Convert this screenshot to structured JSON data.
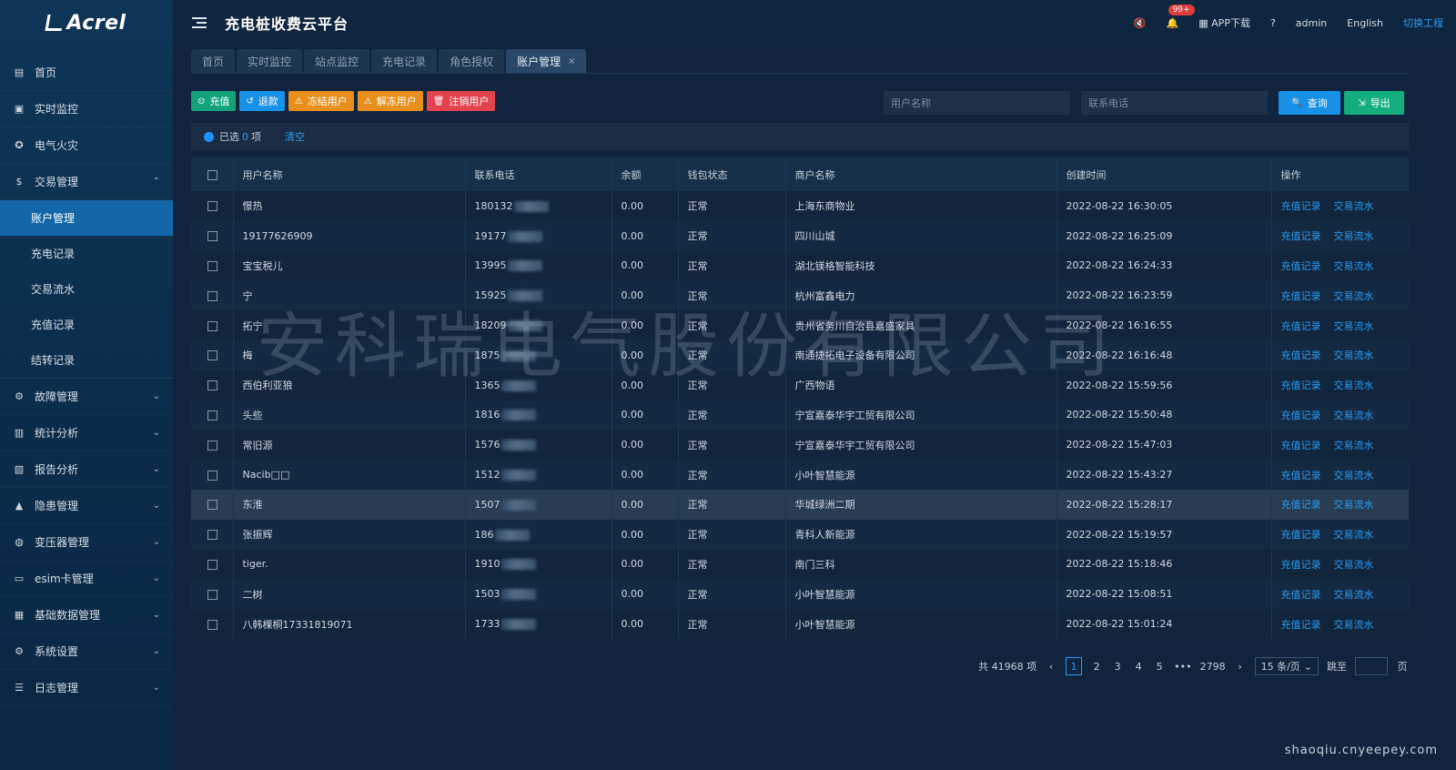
{
  "sidebar": {
    "logo": "Acrel",
    "items": [
      {
        "icon": "home-icon",
        "label": "首页"
      },
      {
        "icon": "monitor-icon",
        "label": "实时监控"
      },
      {
        "icon": "fire-icon",
        "label": "电气火灾"
      },
      {
        "icon": "money-icon",
        "label": "交易管理",
        "expanded": true,
        "children": [
          "账户管理",
          "充电记录",
          "交易流水",
          "充值记录",
          "结转记录"
        ]
      },
      {
        "icon": "fault-icon",
        "label": "故障管理"
      },
      {
        "icon": "chart-icon",
        "label": "统计分析"
      },
      {
        "icon": "report-icon",
        "label": "报告分析"
      },
      {
        "icon": "warning-icon",
        "label": "隐患管理"
      },
      {
        "icon": "transformer-icon",
        "label": "变压器管理"
      },
      {
        "icon": "sim-icon",
        "label": "esim卡管理"
      },
      {
        "icon": "database-icon",
        "label": "基础数据管理"
      },
      {
        "icon": "gear-icon",
        "label": "系统设置"
      },
      {
        "icon": "log-icon",
        "label": "日志管理"
      }
    ],
    "active_child": "账户管理"
  },
  "header": {
    "title": "充电桩收费云平台",
    "badge": "99+",
    "app_download": "APP下载",
    "user": "admin",
    "language": "English",
    "switch_project": "切换工程"
  },
  "tabs": [
    {
      "label": "首页"
    },
    {
      "label": "实时监控"
    },
    {
      "label": "站点监控"
    },
    {
      "label": "充电记录"
    },
    {
      "label": "角色授权"
    },
    {
      "label": "账户管理",
      "active": true,
      "closable": true
    }
  ],
  "toolbar": {
    "recharge": "充值",
    "refund": "退款",
    "freeze": "冻结用户",
    "unfreeze": "解冻用户",
    "cancel": "注销用户"
  },
  "search": {
    "name_placeholder": "用户名称",
    "phone_placeholder": "联系电话",
    "query": "查询",
    "export": "导出"
  },
  "selection": {
    "prefix": "已选",
    "count": "0",
    "suffix": "项",
    "clear": "清空"
  },
  "table": {
    "columns": [
      "用户名称",
      "联系电话",
      "余额",
      "钱包状态",
      "商户名称",
      "创建时间",
      "操作"
    ],
    "actions": [
      "充值记录",
      "交易流水"
    ],
    "rows": [
      {
        "name": "憬热",
        "phone": "180132",
        "balance": "0.00",
        "status": "正常",
        "merchant": "上海东商物业",
        "created": "2022-08-22 16:30:05"
      },
      {
        "name": "19177626909",
        "phone": "19177",
        "balance": "0.00",
        "status": "正常",
        "merchant": "四川山城",
        "created": "2022-08-22 16:25:09"
      },
      {
        "name": "宝宝税儿",
        "phone": "13995",
        "balance": "0.00",
        "status": "正常",
        "merchant": "湖北镁格智能科技",
        "created": "2022-08-22 16:24:33"
      },
      {
        "name": "宁",
        "phone": "15925",
        "balance": "0.00",
        "status": "正常",
        "merchant": "杭州富鑫电力",
        "created": "2022-08-22 16:23:59"
      },
      {
        "name": "拓宁",
        "phone": "18209",
        "balance": "0.00",
        "status": "正常",
        "merchant": "贵州省务川自治县嘉盛家具",
        "created": "2022-08-22 16:16:55"
      },
      {
        "name": "梅",
        "phone": "1875",
        "balance": "0.00",
        "status": "正常",
        "merchant": "南通捷拓电子设备有限公司",
        "created": "2022-08-22 16:16:48"
      },
      {
        "name": "西伯利亚狼",
        "phone": "1365",
        "balance": "0.00",
        "status": "正常",
        "merchant": "广西物语",
        "created": "2022-08-22 15:59:56"
      },
      {
        "name": "头些",
        "phone": "1816",
        "balance": "0.00",
        "status": "正常",
        "merchant": "宁宣嘉泰华宇工贸有限公司",
        "created": "2022-08-22 15:50:48"
      },
      {
        "name": "常旧源",
        "phone": "1576",
        "balance": "0.00",
        "status": "正常",
        "merchant": "宁宣嘉泰华宇工贸有限公司",
        "created": "2022-08-22 15:47:03"
      },
      {
        "name": "Nacib□□",
        "phone": "1512",
        "balance": "0.00",
        "status": "正常",
        "merchant": "小叶智慧能源",
        "created": "2022-08-22 15:43:27"
      },
      {
        "name": "东淮",
        "phone": "1507",
        "balance": "0.00",
        "status": "正常",
        "merchant": "华城绿洲二期",
        "created": "2022-08-22 15:28:17"
      },
      {
        "name": "张振辉",
        "phone": "186",
        "balance": "0.00",
        "status": "正常",
        "merchant": "青科人新能源",
        "created": "2022-08-22 15:19:57"
      },
      {
        "name": "tiger.",
        "phone": "1910",
        "balance": "0.00",
        "status": "正常",
        "merchant": "南门三科",
        "created": "2022-08-22 15:18:46"
      },
      {
        "name": "二树",
        "phone": "1503",
        "balance": "0.00",
        "status": "正常",
        "merchant": "小叶智慧能源",
        "created": "2022-08-22 15:08:51"
      },
      {
        "name": "八韩棵桐17331819071",
        "phone": "1733",
        "balance": "0.00",
        "status": "正常",
        "merchant": "小叶智慧能源",
        "created": "2022-08-22 15:01:24"
      }
    ]
  },
  "watermark": "安科瑞电气股份有限公司",
  "pagination": {
    "total": "共 41968 项",
    "pages": [
      "1",
      "2",
      "3",
      "4",
      "5"
    ],
    "ellipsis": "•••",
    "last": "2798",
    "page_size": "15 条/页",
    "jump_label": "跳至",
    "page_suffix": "页"
  },
  "credit": "shaoqiu.cnyeepey.com"
}
